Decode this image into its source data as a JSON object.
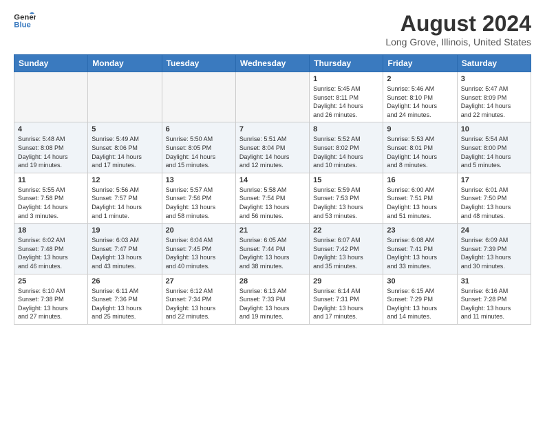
{
  "header": {
    "logo_line1": "General",
    "logo_line2": "Blue",
    "month_year": "August 2024",
    "location": "Long Grove, Illinois, United States"
  },
  "weekdays": [
    "Sunday",
    "Monday",
    "Tuesday",
    "Wednesday",
    "Thursday",
    "Friday",
    "Saturday"
  ],
  "weeks": [
    [
      {
        "day": "",
        "info": ""
      },
      {
        "day": "",
        "info": ""
      },
      {
        "day": "",
        "info": ""
      },
      {
        "day": "",
        "info": ""
      },
      {
        "day": "1",
        "info": "Sunrise: 5:45 AM\nSunset: 8:11 PM\nDaylight: 14 hours\nand 26 minutes."
      },
      {
        "day": "2",
        "info": "Sunrise: 5:46 AM\nSunset: 8:10 PM\nDaylight: 14 hours\nand 24 minutes."
      },
      {
        "day": "3",
        "info": "Sunrise: 5:47 AM\nSunset: 8:09 PM\nDaylight: 14 hours\nand 22 minutes."
      }
    ],
    [
      {
        "day": "4",
        "info": "Sunrise: 5:48 AM\nSunset: 8:08 PM\nDaylight: 14 hours\nand 19 minutes."
      },
      {
        "day": "5",
        "info": "Sunrise: 5:49 AM\nSunset: 8:06 PM\nDaylight: 14 hours\nand 17 minutes."
      },
      {
        "day": "6",
        "info": "Sunrise: 5:50 AM\nSunset: 8:05 PM\nDaylight: 14 hours\nand 15 minutes."
      },
      {
        "day": "7",
        "info": "Sunrise: 5:51 AM\nSunset: 8:04 PM\nDaylight: 14 hours\nand 12 minutes."
      },
      {
        "day": "8",
        "info": "Sunrise: 5:52 AM\nSunset: 8:02 PM\nDaylight: 14 hours\nand 10 minutes."
      },
      {
        "day": "9",
        "info": "Sunrise: 5:53 AM\nSunset: 8:01 PM\nDaylight: 14 hours\nand 8 minutes."
      },
      {
        "day": "10",
        "info": "Sunrise: 5:54 AM\nSunset: 8:00 PM\nDaylight: 14 hours\nand 5 minutes."
      }
    ],
    [
      {
        "day": "11",
        "info": "Sunrise: 5:55 AM\nSunset: 7:58 PM\nDaylight: 14 hours\nand 3 minutes."
      },
      {
        "day": "12",
        "info": "Sunrise: 5:56 AM\nSunset: 7:57 PM\nDaylight: 14 hours\nand 1 minute."
      },
      {
        "day": "13",
        "info": "Sunrise: 5:57 AM\nSunset: 7:56 PM\nDaylight: 13 hours\nand 58 minutes."
      },
      {
        "day": "14",
        "info": "Sunrise: 5:58 AM\nSunset: 7:54 PM\nDaylight: 13 hours\nand 56 minutes."
      },
      {
        "day": "15",
        "info": "Sunrise: 5:59 AM\nSunset: 7:53 PM\nDaylight: 13 hours\nand 53 minutes."
      },
      {
        "day": "16",
        "info": "Sunrise: 6:00 AM\nSunset: 7:51 PM\nDaylight: 13 hours\nand 51 minutes."
      },
      {
        "day": "17",
        "info": "Sunrise: 6:01 AM\nSunset: 7:50 PM\nDaylight: 13 hours\nand 48 minutes."
      }
    ],
    [
      {
        "day": "18",
        "info": "Sunrise: 6:02 AM\nSunset: 7:48 PM\nDaylight: 13 hours\nand 46 minutes."
      },
      {
        "day": "19",
        "info": "Sunrise: 6:03 AM\nSunset: 7:47 PM\nDaylight: 13 hours\nand 43 minutes."
      },
      {
        "day": "20",
        "info": "Sunrise: 6:04 AM\nSunset: 7:45 PM\nDaylight: 13 hours\nand 40 minutes."
      },
      {
        "day": "21",
        "info": "Sunrise: 6:05 AM\nSunset: 7:44 PM\nDaylight: 13 hours\nand 38 minutes."
      },
      {
        "day": "22",
        "info": "Sunrise: 6:07 AM\nSunset: 7:42 PM\nDaylight: 13 hours\nand 35 minutes."
      },
      {
        "day": "23",
        "info": "Sunrise: 6:08 AM\nSunset: 7:41 PM\nDaylight: 13 hours\nand 33 minutes."
      },
      {
        "day": "24",
        "info": "Sunrise: 6:09 AM\nSunset: 7:39 PM\nDaylight: 13 hours\nand 30 minutes."
      }
    ],
    [
      {
        "day": "25",
        "info": "Sunrise: 6:10 AM\nSunset: 7:38 PM\nDaylight: 13 hours\nand 27 minutes."
      },
      {
        "day": "26",
        "info": "Sunrise: 6:11 AM\nSunset: 7:36 PM\nDaylight: 13 hours\nand 25 minutes."
      },
      {
        "day": "27",
        "info": "Sunrise: 6:12 AM\nSunset: 7:34 PM\nDaylight: 13 hours\nand 22 minutes."
      },
      {
        "day": "28",
        "info": "Sunrise: 6:13 AM\nSunset: 7:33 PM\nDaylight: 13 hours\nand 19 minutes."
      },
      {
        "day": "29",
        "info": "Sunrise: 6:14 AM\nSunset: 7:31 PM\nDaylight: 13 hours\nand 17 minutes."
      },
      {
        "day": "30",
        "info": "Sunrise: 6:15 AM\nSunset: 7:29 PM\nDaylight: 13 hours\nand 14 minutes."
      },
      {
        "day": "31",
        "info": "Sunrise: 6:16 AM\nSunset: 7:28 PM\nDaylight: 13 hours\nand 11 minutes."
      }
    ]
  ]
}
